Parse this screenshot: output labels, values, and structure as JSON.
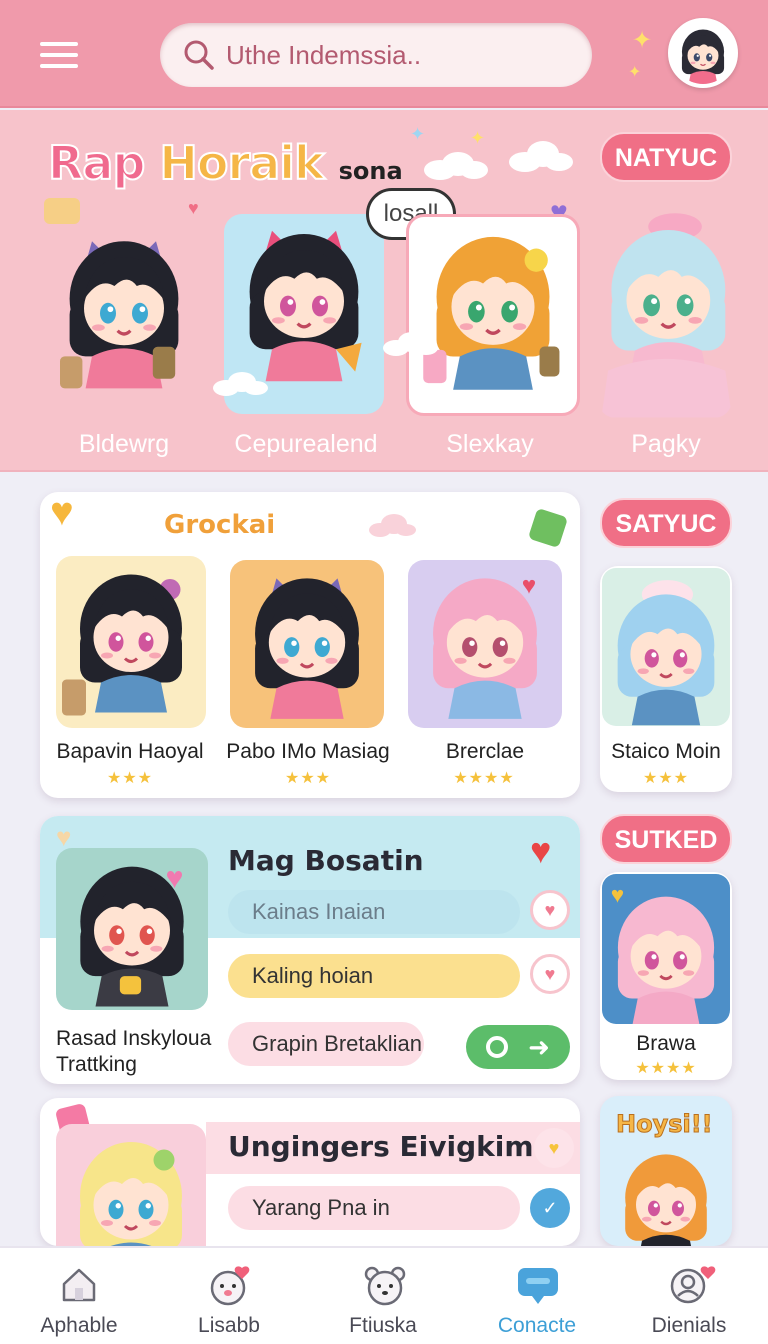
{
  "header": {
    "search_placeholder": "Uthe Indemssia..",
    "menu_icon": "hamburger-menu-icon",
    "search_icon": "search-icon"
  },
  "hero": {
    "title_part1": "Rap",
    "title_part2": "Horaik",
    "title_suffix": "sona",
    "badge": "NATYUC",
    "speech_bubble": "losall",
    "characters": [
      {
        "name": "Bldewrg"
      },
      {
        "name": "Cepurealend"
      },
      {
        "name": "Slexkay"
      },
      {
        "name": "Pagky"
      }
    ]
  },
  "group_card": {
    "title": "Grockai",
    "characters": [
      {
        "name": "Bapavin Haoyal",
        "stars": "★★★"
      },
      {
        "name": "Pabo IMo Masiag",
        "stars": "★★★"
      },
      {
        "name": "Brerclae",
        "stars": "★★★★"
      }
    ]
  },
  "side1": {
    "badge": "SATYUC",
    "name": "Staico Moin",
    "stars": "★★★"
  },
  "feature_card": {
    "title": "Mag Bosatin",
    "caption_line1": "Rasad Inskyloua",
    "caption_line2": "Trattking",
    "chip1": "Kainas Inaian",
    "chip2": "Kaling hoian",
    "chip3": "Grapin Bretaklian"
  },
  "side2": {
    "badge": "SUTKED",
    "name": "Brawa",
    "stars": "★★★★"
  },
  "card4": {
    "title": "Ungingers Eivigkim",
    "chip1": "Yarang Pna in"
  },
  "side3": {
    "title": "Hoysi!!"
  },
  "nav": [
    {
      "label": "Aphable",
      "icon": "home-icon"
    },
    {
      "label": "Lisabb",
      "icon": "face-heart-icon"
    },
    {
      "label": "Ftiuska",
      "icon": "bear-icon"
    },
    {
      "label": "Conacte",
      "icon": "chat-icon"
    },
    {
      "label": "Dienials",
      "icon": "profile-icon"
    }
  ],
  "colors": {
    "topbar": "#f09aab",
    "hero_bg": "#f7c3cb",
    "accent_pink": "#f06f86",
    "active_blue": "#3d9fd6",
    "go_green": "#5cbd6a"
  }
}
